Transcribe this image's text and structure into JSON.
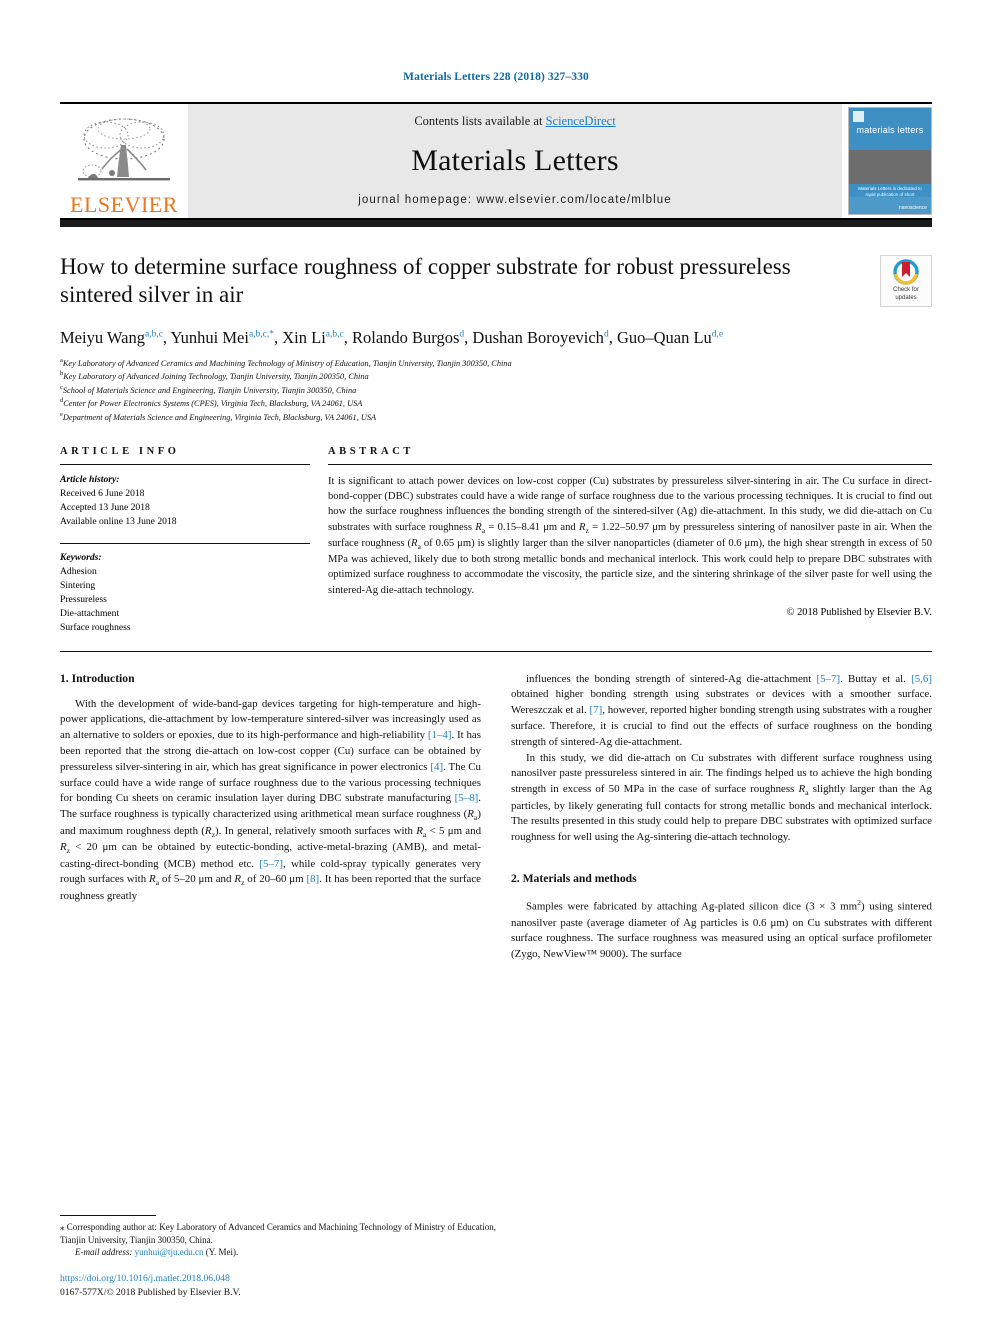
{
  "running_head": "Materials Letters 228 (2018) 327–330",
  "masthead": {
    "publisher": "ELSEVIER",
    "contents_prefix": "Contents lists available at ",
    "contents_link": "ScienceDirect",
    "journal_title": "Materials Letters",
    "homepage": "journal homepage: www.elsevier.com/locate/mlblue",
    "cover": {
      "title": "materials letters",
      "caption": "Materials Letters is dedicated to rapid publication of short communications on materials science and engineering",
      "brand": "nanoscience"
    }
  },
  "article": {
    "title": "How to determine surface roughness of copper substrate for robust pressureless sintered silver in air",
    "crossmark": {
      "line1": "Check for",
      "line2": "updates"
    },
    "authors_html": "Meiyu Wang<sup>a,b,c</sup>, Yunhui Mei<sup>a,b,c,*</sup>, Xin Li<sup>a,b,c</sup>, Rolando Burgos<sup>d</sup>, Dushan Boroyevich<sup>d</sup>, Guo–Quan Lu<sup>d,e</sup>",
    "affiliations": [
      {
        "mark": "a",
        "text": "Key Laboratory of Advanced Ceramics and Machining Technology of Ministry of Education, Tianjin University, Tianjin 300350, China"
      },
      {
        "mark": "b",
        "text": "Key Laboratory of Advanced Joining Technology, Tianjin University, Tianjin 200350, China"
      },
      {
        "mark": "c",
        "text": "School of Materials Science and Engineering, Tianjin University, Tianjin 300350, China"
      },
      {
        "mark": "d",
        "text": "Center for Power Electronics Systems (CPES), Virginia Tech, Blacksburg, VA 24061, USA"
      },
      {
        "mark": "e",
        "text": "Department of Materials Science and Engineering, Virginia Tech, Blacksburg, VA 24061, USA"
      }
    ]
  },
  "article_info": {
    "heading": "ARTICLE INFO",
    "history_label": "Article history:",
    "history": [
      "Received 6 June 2018",
      "Accepted 13 June 2018",
      "Available online 13 June 2018"
    ],
    "keywords_label": "Keywords:",
    "keywords": [
      "Adhesion",
      "Sintering",
      "Pressureless",
      "Die-attachment",
      "Surface roughness"
    ]
  },
  "abstract": {
    "heading": "ABSTRACT",
    "text_html": "It is significant to attach power devices on low-cost copper (Cu) substrates by pressureless silver-sintering in air. The Cu surface in direct-bond-copper (DBC) substrates could have a wide range of surface roughness due to the various processing techniques. It is crucial to find out how the surface roughness influences the bonding strength of the sintered-silver (Ag) die-attachment. In this study, we did die-attach on Cu substrates with surface roughness <i>R</i><sub>a</sub> = 0.15–8.41 μm and <i>R</i><sub>z</sub> = 1.22–50.97 μm by pressureless sintering of nanosilver paste in air. When the surface roughness (<i>R</i><sub>a</sub> of 0.65 μm) is slightly larger than the silver nanoparticles (diameter of 0.6 μm), the high shear strength in excess of 50 MPa was achieved, likely due to both strong metallic bonds and mechanical interlock. This work could help to prepare DBC substrates with optimized surface roughness to accommodate the viscosity, the particle size, and the sintering shrinkage of the silver paste for well using the sintered-Ag die-attach technology.",
    "copyright": "© 2018 Published by Elsevier B.V."
  },
  "body": {
    "section1_heading": "1. Introduction",
    "section2_heading": "2. Materials and methods",
    "left_p1_html": "With the development of wide-band-gap devices targeting for high-temperature and high-power applications, die-attachment by low-temperature sintered-silver was increasingly used as an alternative to solders or epoxies, due to its high-performance and high-reliability <span class=\"ref\">[1–4]</span>. It has been reported that the strong die-attach on low-cost copper (Cu) surface can be obtained by pressureless silver-sintering in air, which has great significance in power electronics <span class=\"ref\">[4]</span>. The Cu surface could have a wide range of surface roughness due to the various processing techniques for bonding Cu sheets on ceramic insulation layer during DBC substrate manufacturing <span class=\"ref\">[5–8]</span>. The surface roughness is typically characterized using arithmetical mean surface roughness (<i>R</i><sub>a</sub>) and maximum roughness depth (<i>R</i><sub>z</sub>). In general, relatively smooth surfaces with <i>R</i><sub>a</sub> &lt; 5 μm and <i>R</i><sub>z</sub> &lt; 20 μm can be obtained by eutectic-bonding, active-metal-brazing (AMB), and metal-casting-direct-bonding (MCB) method etc. <span class=\"ref\">[5–7]</span>, while cold-spray typically generates very rough surfaces with <i>R</i><sub>a</sub> of 5–20 μm and <i>R</i><sub>z</sub> of 20–60 μm <span class=\"ref\">[8]</span>. It has been reported that the surface roughness greatly",
    "right_p1_html": "influences the bonding strength of sintered-Ag die-attachment <span class=\"ref\">[5–7]</span>. Buttay et al. <span class=\"ref\">[5,6]</span> obtained higher bonding strength using substrates or devices with a smoother surface. Wereszczak et al. <span class=\"ref\">[7]</span>, however, reported higher bonding strength using substrates with a rougher surface. Therefore, it is crucial to find out the effects of surface roughness on the bonding strength of sintered-Ag die-attachment.",
    "right_p2_html": "In this study, we did die-attach on Cu substrates with different surface roughness using nanosilver paste pressureless sintered in air. The findings helped us to achieve the high bonding strength in excess of 50 MPa in the case of surface roughness <i>R</i><sub>a</sub> slightly larger than the Ag particles, by likely generating full contacts for strong metallic bonds and mechanical interlock. The results presented in this study could help to prepare DBC substrates with optimized surface roughness for well using the Ag-sintering die-attach technology.",
    "right_p3_html": "Samples were fabricated by attaching Ag-plated silicon dice (3 × 3 mm<sup>2</sup>) using sintered nanosilver paste (average diameter of Ag particles is 0.6 μm) on Cu substrates with different surface roughness. The surface roughness was measured using an optical surface profilometer (Zygo, NewView™ 9000). The surface"
  },
  "footer": {
    "corresponding_html": "⁎ Corresponding author at: Key Laboratory of Advanced Ceramics and Machining Technology of Ministry of Education, Tianjin University, Tianjin 300350, China.",
    "email_label": "E-mail address:",
    "email": "yunhui@tju.edu.cn",
    "email_suffix": "(Y. Mei).",
    "doi": "https://doi.org/10.1016/j.matlet.2018.06.048",
    "issn": "0167-577X/© 2018 Published by Elsevier B.V."
  },
  "colors": {
    "link_blue": "#1f7fc0",
    "elsevier_orange": "#E87722",
    "cover_blue": "#3d8fc4"
  }
}
